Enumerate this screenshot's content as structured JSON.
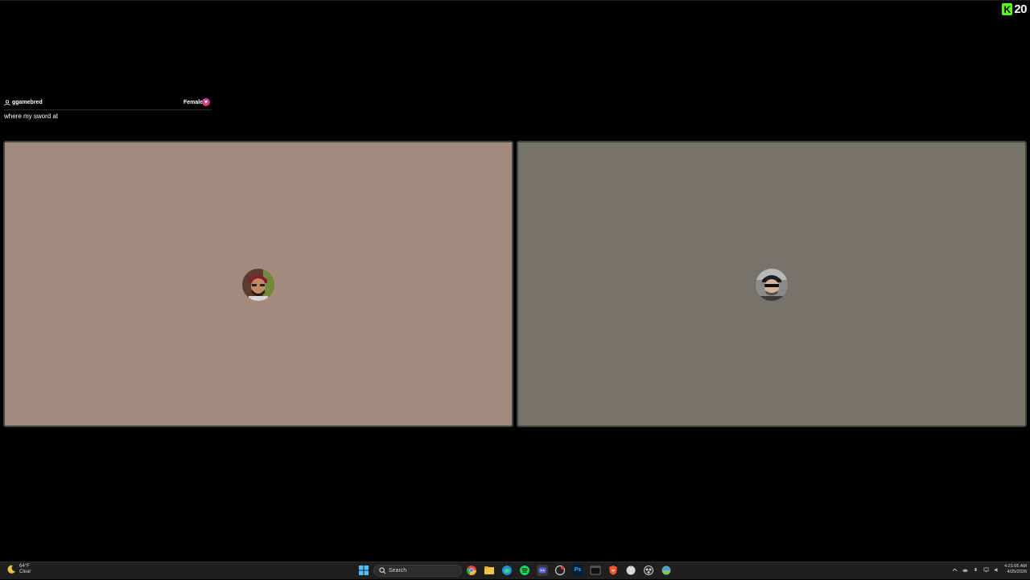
{
  "brand": {
    "logo_letter": "K",
    "count": "20",
    "accent": "#53fc18"
  },
  "user": {
    "name": "ggamebred",
    "gender": "Female",
    "gender_color": "#d23c8a"
  },
  "message": "where my sword at",
  "video_tiles": [
    {
      "name": "left-participant",
      "background": "#a38a7c"
    },
    {
      "name": "right-participant",
      "background": "#76726c"
    }
  ],
  "taskbar": {
    "weather": {
      "temp": "64°F",
      "condition": "Clear"
    },
    "search_placeholder": "Search",
    "photoshop_label": "Ps",
    "clock": {
      "time": "4:21:05 AM",
      "date": "4/25/2026"
    }
  }
}
